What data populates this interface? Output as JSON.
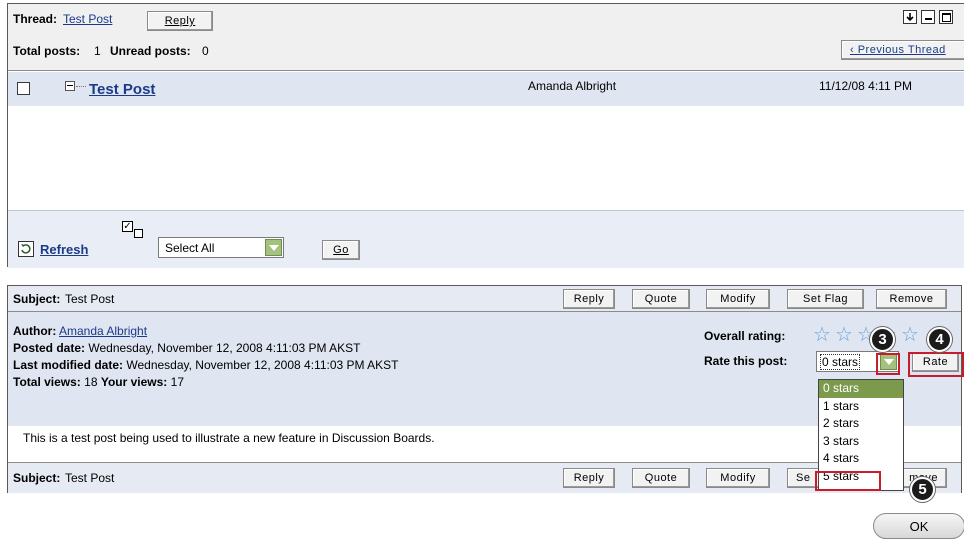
{
  "thread": {
    "label": "Thread:",
    "title": "Test Post",
    "reply_button": "Reply",
    "total_posts_label": "Total posts:",
    "total_posts": "1",
    "unread_posts_label": "Unread posts:",
    "unread_posts": "0",
    "previous_thread": "‹ Previous Thread",
    "post": {
      "title": "Test Post",
      "author": "Amanda Albright",
      "date": "11/12/08 4:11 PM"
    },
    "footer": {
      "refresh": "Refresh",
      "select_value": "Select All",
      "go_button": "Go"
    }
  },
  "post": {
    "subject_label": "Subject:",
    "subject": "Test Post",
    "buttons": {
      "reply": "Reply",
      "quote": "Quote",
      "modify": "Modify",
      "set_flag": "Set Flag",
      "remove": "Remove"
    },
    "author_label": "Author:",
    "author": "Amanda Albright",
    "posted_label": "Posted date:",
    "posted": "Wednesday, November 12, 2008 4:11:03 PM AKST",
    "modified_label": "Last modified date:",
    "modified": "Wednesday, November 12, 2008 4:11:03 PM AKST",
    "total_views_label": "Total views:",
    "total_views": "18",
    "your_views_label": "Your views:",
    "your_views": "17",
    "overall_rating_label": "Overall rating:",
    "rate_label": "Rate this post:",
    "rate_select_value": "0 stars",
    "rate_button": "Rate",
    "body": "This is a test post being used to illustrate a new feature in Discussion Boards.",
    "bottom_buttons": {
      "reply": "Reply",
      "quote": "Quote",
      "modify": "Modify",
      "set_flag_partial": "Se",
      "remove_partial": "move"
    }
  },
  "rating_options": [
    "0 stars",
    "1 stars",
    "2 stars",
    "3 stars",
    "4 stars",
    "5 stars"
  ],
  "callouts": {
    "step3": "3",
    "step4": "4",
    "step5": "5"
  },
  "ok_button": "OK",
  "colors": {
    "header_bg": "#f0f0f0",
    "row_bg": "#dfe6f1",
    "link": "#1a3a8a",
    "highlight_red": "#c81c2a",
    "select_green": "#a4c27e",
    "selected_option": "#7b9a4c",
    "star": "#6aa0d6"
  }
}
